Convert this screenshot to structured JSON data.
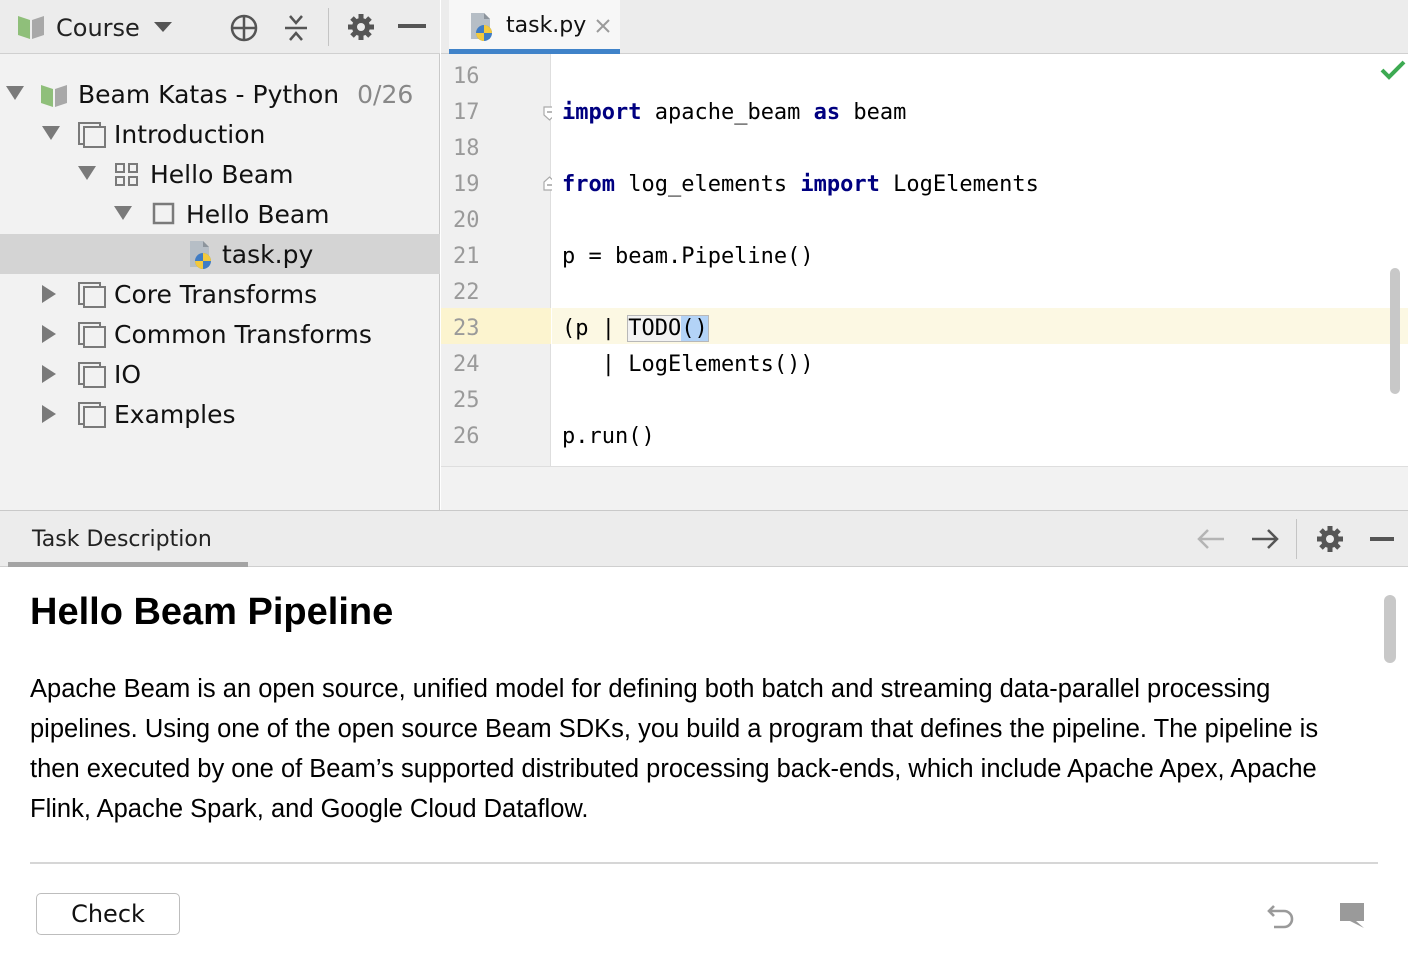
{
  "left_panel": {
    "title": "Course",
    "tree": [
      {
        "label": "Beam Katas - Python",
        "count": "0/26",
        "expanded": true,
        "icon": "book-icon"
      },
      {
        "label": "Introduction",
        "expanded": true,
        "icon": "section-icon"
      },
      {
        "label": "Hello Beam",
        "expanded": true,
        "icon": "lesson-grid-icon"
      },
      {
        "label": "Hello Beam",
        "expanded": true,
        "icon": "task-square-icon"
      },
      {
        "label": "task.py",
        "selected": true,
        "icon": "python-file-icon"
      },
      {
        "label": "Core Transforms",
        "expanded": false,
        "icon": "section-icon"
      },
      {
        "label": "Common Transforms",
        "expanded": false,
        "icon": "section-icon"
      },
      {
        "label": "IO",
        "expanded": false,
        "icon": "section-icon"
      },
      {
        "label": "Examples",
        "expanded": false,
        "icon": "section-icon"
      }
    ]
  },
  "editor": {
    "tab_label": "task.py",
    "line_numbers": [
      "16",
      "17",
      "18",
      "19",
      "20",
      "21",
      "22",
      "23",
      "24",
      "25",
      "26"
    ],
    "code": {
      "l17_kw1": "import",
      "l17_mid": " apache_beam ",
      "l17_kw2": "as",
      "l17_end": " beam",
      "l19_kw1": "from",
      "l19_mid": " log_elements ",
      "l19_kw2": "import",
      "l19_end": " LogElements",
      "l21": "p = beam.Pipeline()",
      "l23_start": "(p | ",
      "l23_todo": "TODO",
      "l23_parens": "()",
      "l24": "   | LogElements())",
      "l26": "p.run()"
    },
    "status_color": "#3daa52"
  },
  "task": {
    "tab_label": "Task Description",
    "title": "Hello Beam Pipeline",
    "body": "Apache Beam is an open source, unified model for defining both batch and streaming data-parallel processing pipelines. Using one of the open source Beam SDKs, you build a program that defines the pipeline. The pipeline is then executed by one of Beam’s supported distributed processing back-ends, which include Apache Apex, Apache Flink, Apache Spark, and Google Cloud Dataflow.",
    "check_label": "Check"
  },
  "colors": {
    "keyword": "#000080",
    "tab_underline": "#4083c9",
    "current_line": "#fcf8e3"
  }
}
